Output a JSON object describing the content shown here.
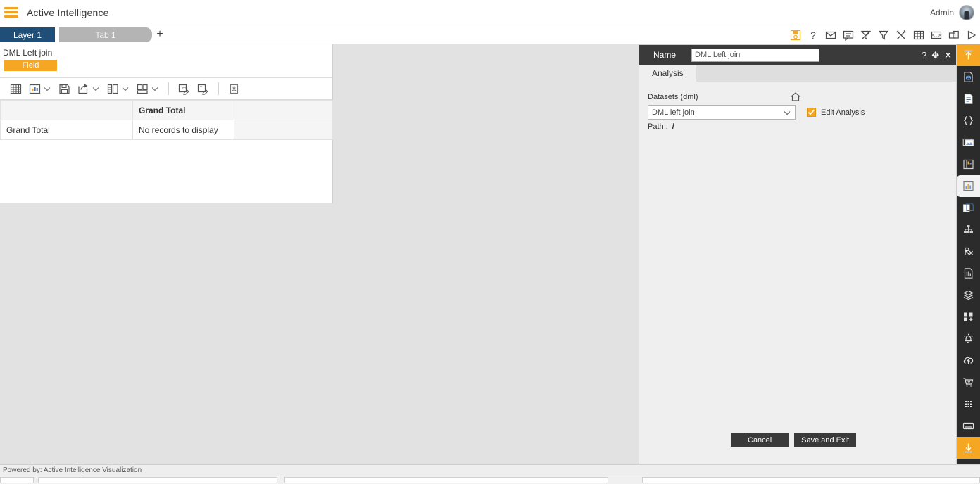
{
  "appbar": {
    "menu_icon": "hamburger-icon",
    "title": "Active Intelligence",
    "user_label": "Admin",
    "avatar_icon": "user-avatar"
  },
  "tabstrip": {
    "layer_tab": "Layer 1",
    "sheet_tab": "Tab 1",
    "add_tab": "+",
    "icons": [
      {
        "name": "save-report-icon",
        "accent": "#f5a623"
      },
      {
        "name": "help-question-icon",
        "accent": "#4a4a4a"
      },
      {
        "name": "mail-envelope-icon",
        "accent": "#4a4a4a"
      },
      {
        "name": "comment-bubble-icon",
        "accent": "#4a4a4a"
      },
      {
        "name": "clear-filter-icon",
        "accent": "#4a4a4a"
      },
      {
        "name": "filter-funnel-icon",
        "accent": "#4a4a4a"
      },
      {
        "name": "tools-settings-icon",
        "accent": "#4a4a4a"
      },
      {
        "name": "grid-table-icon",
        "accent": "#4a4a4a"
      },
      {
        "name": "code-window-icon",
        "accent": "#4a4a4a"
      },
      {
        "name": "copy-pages-icon",
        "accent": "#4a4a4a"
      },
      {
        "name": "play-run-icon",
        "accent": "#4a4a4a"
      }
    ]
  },
  "sheet": {
    "title": "DML Left join",
    "field_chip": "Field",
    "toolbar": [
      {
        "name": "table-view-icon",
        "caret": false
      },
      {
        "name": "chart-view-icon",
        "caret": true
      },
      {
        "name": "save-icon",
        "caret": false
      },
      {
        "name": "export-share-icon",
        "caret": true
      },
      {
        "name": "column-layout-icon",
        "caret": true
      },
      {
        "name": "panel-layout-icon",
        "caret": true
      },
      {
        "name": "edit-formula-icon",
        "caret": false
      },
      {
        "name": "edit-text-icon",
        "caret": false
      },
      {
        "name": "page-setup-icon",
        "caret": false
      }
    ],
    "table": {
      "columns": [
        "",
        "Grand Total",
        ""
      ],
      "rows": [
        {
          "cells": [
            "Grand Total",
            "No records to display",
            ""
          ]
        }
      ]
    }
  },
  "dialog": {
    "name_label": "Name",
    "name_value": "DML Left join",
    "title_icons": [
      {
        "name": "help-question-icon",
        "glyph": "?"
      },
      {
        "name": "move-drag-icon",
        "glyph": "✥"
      },
      {
        "name": "close-icon",
        "glyph": "✕"
      }
    ],
    "tabs": [
      {
        "label": "Analysis",
        "active": true
      }
    ],
    "datasets_label": "Datasets (dml)",
    "home_icon": "home-icon",
    "dataset_value": "DML left join",
    "dropdown_icon": "chevron-down-icon",
    "edit_analysis_label": "Edit Analysis",
    "edit_analysis_checked": true,
    "path_label": "Path :",
    "path_value": "/",
    "cancel_label": "Cancel",
    "save_label": "Save and Exit"
  },
  "rail": {
    "items": [
      {
        "name": "rail-scroll-up",
        "icon": "arrow-up-bar-icon",
        "style": "accent"
      },
      {
        "name": "rail-dataset",
        "icon": "document-database-icon",
        "style": "normal"
      },
      {
        "name": "rail-document",
        "icon": "document-lines-icon",
        "style": "normal"
      },
      {
        "name": "rail-code",
        "icon": "braces-code-icon",
        "style": "normal"
      },
      {
        "name": "rail-image",
        "icon": "image-stack-icon",
        "style": "normal"
      },
      {
        "name": "rail-layout",
        "icon": "layout-panel-icon",
        "style": "normal"
      },
      {
        "name": "rail-analysis",
        "icon": "chart-analysis-icon",
        "style": "active"
      },
      {
        "name": "rail-copy",
        "icon": "copy-pages-icon",
        "style": "normal"
      },
      {
        "name": "rail-hierarchy",
        "icon": "hierarchy-tree-icon",
        "style": "normal"
      },
      {
        "name": "rail-prescription",
        "icon": "rx-formula-icon",
        "style": "normal"
      },
      {
        "name": "rail-report",
        "icon": "document-report-icon",
        "style": "normal"
      },
      {
        "name": "rail-layers",
        "icon": "layers-stack-icon",
        "style": "normal"
      },
      {
        "name": "rail-add-widget",
        "icon": "add-widget-icon",
        "style": "normal"
      },
      {
        "name": "rail-alerts",
        "icon": "bell-alert-icon",
        "style": "normal"
      },
      {
        "name": "rail-upload",
        "icon": "cloud-upload-icon",
        "style": "normal"
      },
      {
        "name": "rail-cart",
        "icon": "cart-add-icon",
        "style": "normal"
      },
      {
        "name": "rail-grid",
        "icon": "grid-dots-icon",
        "style": "normal"
      },
      {
        "name": "rail-console",
        "icon": "console-window-icon",
        "style": "normal"
      },
      {
        "name": "rail-scroll-down",
        "icon": "arrow-down-bar-icon",
        "style": "accent"
      }
    ]
  },
  "footer": {
    "text": "Powered by: Active Intelligence Visualization"
  }
}
